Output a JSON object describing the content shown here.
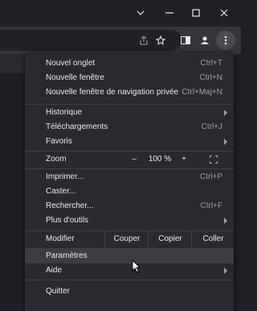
{
  "window": {
    "controls": [
      {
        "name": "dropdown-icon",
        "glyph": "⌄"
      },
      {
        "name": "minimize-icon",
        "glyph": "—"
      },
      {
        "name": "maximize-icon",
        "glyph": "☐"
      },
      {
        "name": "close-icon",
        "glyph": "✕"
      }
    ]
  },
  "toolbar": {
    "icons": [
      "share-icon",
      "bookmark-star-icon",
      "side-panel-icon",
      "profile-icon",
      "more-menu-icon"
    ]
  },
  "menu": {
    "new_tab": {
      "label": "Nouvel onglet",
      "shortcut": "Ctrl+T"
    },
    "new_window": {
      "label": "Nouvelle fenêtre",
      "shortcut": "Ctrl+N"
    },
    "new_private": {
      "label": "Nouvelle fenêtre de navigation privée",
      "shortcut": "Ctrl+Maj+N"
    },
    "history": {
      "label": "Historique"
    },
    "downloads": {
      "label": "Téléchargements",
      "shortcut": "Ctrl+J"
    },
    "favorites": {
      "label": "Favoris"
    },
    "zoom": {
      "label": "Zoom",
      "minus": "–",
      "value": "100 %",
      "plus": "+",
      "fullscreen": "⛶"
    },
    "print": {
      "label": "Imprimer...",
      "shortcut": "Ctrl+P"
    },
    "cast": {
      "label": "Caster..."
    },
    "find": {
      "label": "Rechercher...",
      "shortcut": "Ctrl+F"
    },
    "more_tools": {
      "label": "Plus d'outils"
    },
    "edit": {
      "label": "Modifier",
      "cut": "Couper",
      "copy": "Copier",
      "paste": "Coller"
    },
    "settings": {
      "label": "Paramètres"
    },
    "help": {
      "label": "Aide"
    },
    "quit": {
      "label": "Quitter"
    }
  },
  "colors": {
    "menu_bg": "#292a2d",
    "hover_bg": "#3c3d41",
    "text": "#e8eaed",
    "muted": "#9aa0a6"
  }
}
